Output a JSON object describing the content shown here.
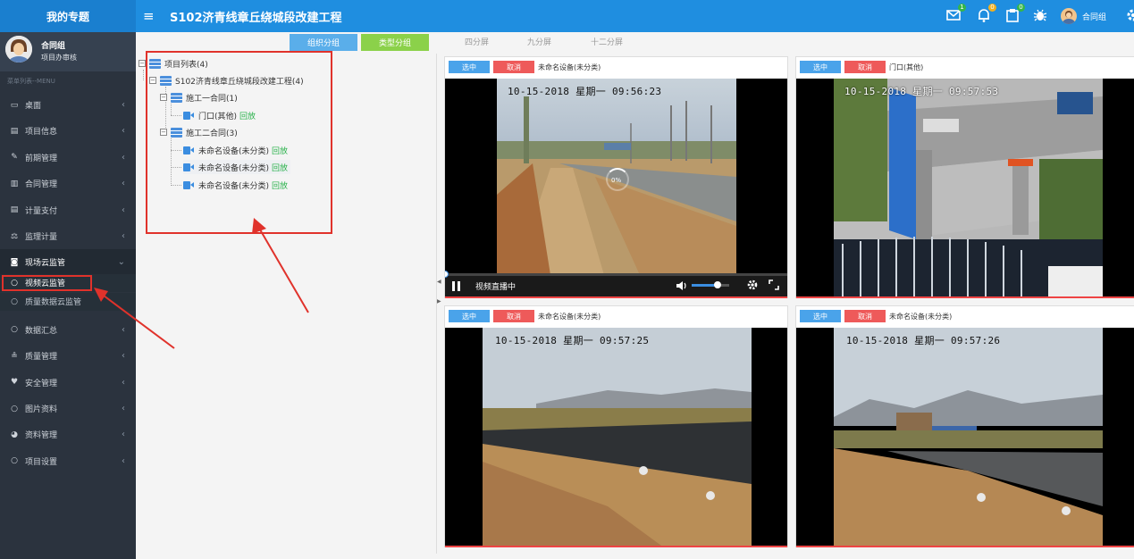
{
  "header": {
    "brand": "我的专题",
    "menu_icon": "≡",
    "project_title": "S102济青线章丘绕城段改建工程",
    "icons": [
      {
        "name": "message-icon",
        "badge": "1",
        "badge_color": "#35b649"
      },
      {
        "name": "bell-icon",
        "badge": "0",
        "badge_color": "#f2b01e"
      },
      {
        "name": "clipboard-icon",
        "badge": "0",
        "badge_color": "#35b649"
      },
      {
        "name": "bug-icon",
        "badge": ""
      }
    ],
    "username": "合同组"
  },
  "sidebar": {
    "profile": {
      "name": "合同组",
      "role": "项目办审核"
    },
    "menu_caption": "菜单列表--MENU",
    "items": [
      {
        "icon": "monitor-icon",
        "glyph": "▭",
        "label": "桌面",
        "arrow": "‹"
      },
      {
        "icon": "file-icon",
        "glyph": "▤",
        "label": "项目信息",
        "arrow": "‹"
      },
      {
        "icon": "edit-icon",
        "glyph": "✎",
        "label": "前期管理",
        "arrow": "‹"
      },
      {
        "icon": "book-icon",
        "glyph": "▥",
        "label": "合同管理",
        "arrow": "‹"
      },
      {
        "icon": "doc-icon",
        "glyph": "▤",
        "label": "计量支付",
        "arrow": "‹"
      },
      {
        "icon": "scale-icon",
        "glyph": "⚖",
        "label": "监理计量",
        "arrow": "‹"
      },
      {
        "icon": "camera-icon",
        "glyph": "◙",
        "label": "现场云监管",
        "arrow": "⌄"
      },
      {
        "icon": "circle-icon",
        "glyph": "○",
        "label": "数据汇总",
        "arrow": "‹"
      },
      {
        "icon": "quality-icon",
        "glyph": "≗",
        "label": "质量管理",
        "arrow": "‹"
      },
      {
        "icon": "heart-icon",
        "glyph": "♥",
        "label": "安全管理",
        "arrow": "‹"
      },
      {
        "icon": "circle-icon",
        "glyph": "○",
        "label": "图片资料",
        "arrow": "‹"
      },
      {
        "icon": "globe-icon",
        "glyph": "◕",
        "label": "资料管理",
        "arrow": "‹"
      },
      {
        "icon": "circle-icon",
        "glyph": "○",
        "label": "项目设置",
        "arrow": "‹"
      }
    ],
    "sub_items": [
      {
        "label": "视频云监管",
        "glyph": "○",
        "active": true
      },
      {
        "label": "质量数据云监管",
        "glyph": "○",
        "active": false
      }
    ]
  },
  "tree_tabs": [
    {
      "label": "组织分组",
      "color": "#5aaeea"
    },
    {
      "label": "类型分组",
      "color": "#8bd14a"
    }
  ],
  "tree": {
    "root": "项目列表(4)",
    "project": "S102济青线章丘绕城段改建工程(4)",
    "contract1": "施工一合同(1)",
    "c1_cam": "门口(其他)",
    "contract2": "施工二合同(3)",
    "c2_cams": [
      "未命名设备(未分类)",
      "未命名设备(未分类)",
      "未命名设备(未分类)"
    ],
    "playback": "回放"
  },
  "split_tabs": [
    "四分屏",
    "九分屏",
    "十二分屏"
  ],
  "panels": [
    {
      "select": "选中",
      "cancel": "取消",
      "camera": "未命名设备(未分类)",
      "timestamp": "10-15-2018 星期一 09:56:23",
      "loading": "0%",
      "status": "视频直播中",
      "progress": 0.0,
      "volume": 0.7
    },
    {
      "select": "选中",
      "cancel": "取消",
      "camera": "门口(其他)",
      "timestamp": "10-15-2018 星期一 09:57:53"
    },
    {
      "select": "选中",
      "cancel": "取消",
      "camera": "未命名设备(未分类)",
      "timestamp": "10-15-2018 星期一 09:57:25"
    },
    {
      "select": "选中",
      "cancel": "取消",
      "camera": "未命名设备(未分类)",
      "timestamp": "10-15-2018 星期一 09:57:26"
    }
  ],
  "colors": {
    "accent": "#1f8ee0",
    "highlight": "#e0322b",
    "playback": "#2bb24c"
  }
}
